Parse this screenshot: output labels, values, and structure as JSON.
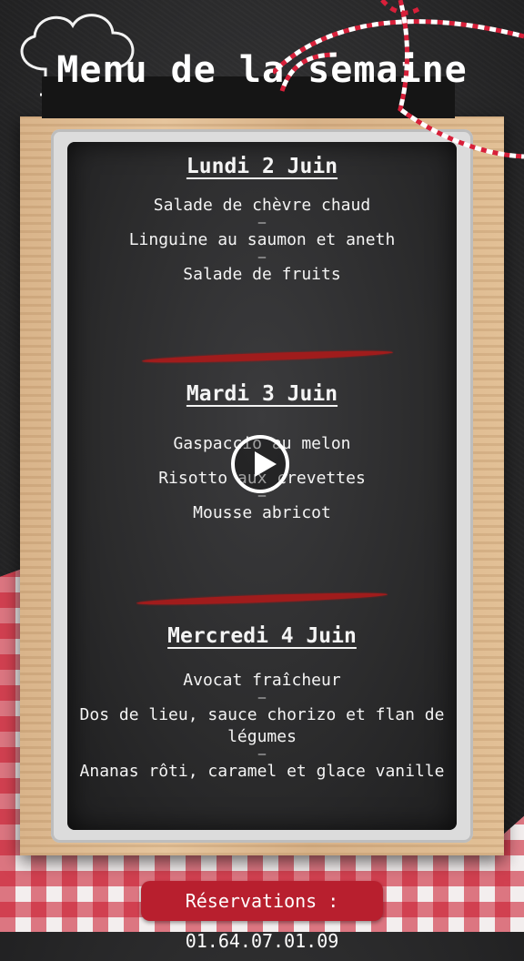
{
  "title": "Menu de la semaine",
  "days": [
    {
      "title": "Lundi 2 Juin",
      "dishes": [
        "Salade de chèvre chaud",
        "Linguine au saumon et aneth",
        "Salade de fruits"
      ]
    },
    {
      "title": "Mardi 3 Juin",
      "dishes": [
        "Gaspaccio au melon",
        "Risotto aux crevettes",
        "Mousse abricot"
      ]
    },
    {
      "title": "Mercredi 4 Juin",
      "dishes": [
        "Avocat fraîcheur",
        "Dos de lieu, sauce chorizo et flan de légumes",
        "Ananas rôti, caramel et glace vanille"
      ]
    }
  ],
  "separator": "–",
  "reservations": "Réservations :  01.64.07.01.09",
  "icons": [
    "chef-hat-icon",
    "play-icon",
    "twine-decoration"
  ],
  "colors": {
    "accent_red": "#b81f2e",
    "chalkboard": "#2b2b2c",
    "wood": "#dfbd93"
  }
}
